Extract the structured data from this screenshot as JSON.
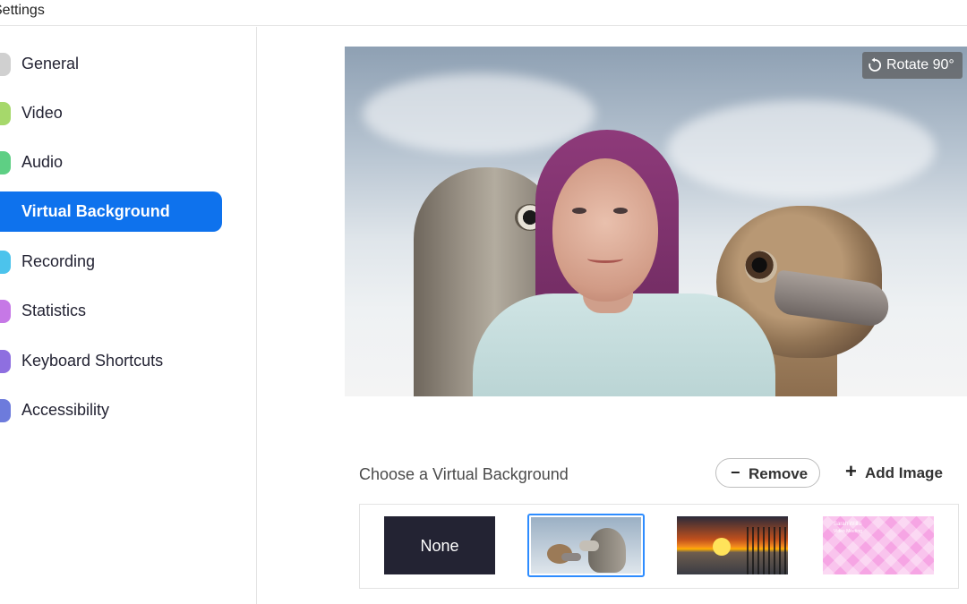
{
  "window": {
    "title": "Settings"
  },
  "sidebar": {
    "items": [
      {
        "label": "General",
        "icon": "gear-icon",
        "color": "#d0d0d0",
        "active": false
      },
      {
        "label": "Video",
        "icon": "video-icon",
        "color": "#a6d86b",
        "active": false
      },
      {
        "label": "Audio",
        "icon": "headphones-icon",
        "color": "#5ecf84",
        "active": false
      },
      {
        "label": "Virtual Background",
        "icon": "virtual-background-icon",
        "color": "#0e72ed",
        "active": true
      },
      {
        "label": "Recording",
        "icon": "recording-icon",
        "color": "#4cc3ec",
        "active": false
      },
      {
        "label": "Statistics",
        "icon": "statistics-icon",
        "color": "#c678e6",
        "active": false
      },
      {
        "label": "Keyboard Shortcuts",
        "icon": "keyboard-icon",
        "color": "#8e6fe0",
        "active": false
      },
      {
        "label": "Accessibility",
        "icon": "accessibility-icon",
        "color": "#6d7bdc",
        "active": false
      }
    ]
  },
  "preview": {
    "rotate_label": "Rotate 90°",
    "rotate_icon": "rotate-icon"
  },
  "backgrounds": {
    "heading": "Choose a Virtual Background",
    "remove_label": "Remove",
    "remove_icon": "minus-icon",
    "add_label": "Add Image",
    "add_icon": "plus-icon",
    "selected_index": 1,
    "items": [
      {
        "label": "None",
        "type": "none"
      },
      {
        "label": "",
        "type": "ostriches"
      },
      {
        "label": "",
        "type": "sunset"
      },
      {
        "label": "",
        "type": "pink-pattern"
      }
    ],
    "pink_text_line1": "Sarah Willis",
    "pink_text_line2": "Video Meeting"
  },
  "colors": {
    "accent": "#0e72ed",
    "selected_border": "#2d8cff"
  }
}
